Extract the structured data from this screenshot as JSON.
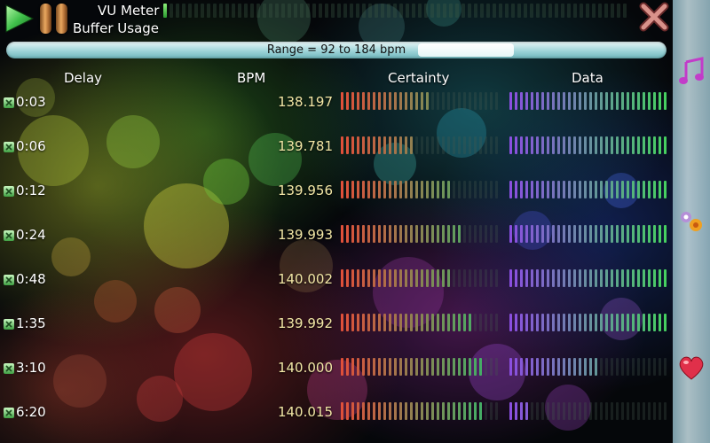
{
  "topbar": {
    "vu_label": "VU Meter",
    "buffer_label": "Buffer Usage"
  },
  "range": {
    "text": "Range = 92 to 184 bpm"
  },
  "columns": {
    "delay": "Delay",
    "bpm": "BPM",
    "certainty": "Certainty",
    "data": "Data"
  },
  "rows": [
    {
      "delay": "0:03",
      "bpm": "138.197",
      "certainty": 0.56,
      "data": 1.0
    },
    {
      "delay": "0:06",
      "bpm": "139.781",
      "certainty": 0.46,
      "data": 1.0
    },
    {
      "delay": "0:12",
      "bpm": "139.956",
      "certainty": 0.69,
      "data": 1.0
    },
    {
      "delay": "0:24",
      "bpm": "139.993",
      "certainty": 0.76,
      "data": 1.0
    },
    {
      "delay": "0:48",
      "bpm": "140.002",
      "certainty": 0.69,
      "data": 1.0
    },
    {
      "delay": "1:35",
      "bpm": "139.992",
      "certainty": 0.82,
      "data": 1.0
    },
    {
      "delay": "3:10",
      "bpm": "140.000",
      "certainty": 0.89,
      "data": 0.57
    },
    {
      "delay": "6:20",
      "bpm": "140.015",
      "certainty": 0.91,
      "data": 0.12
    }
  ],
  "icons": {
    "play": "play-icon",
    "pause": "pause-icon",
    "close": "close-icon",
    "music": "music-note-icon",
    "flowers": "flowers-icon",
    "heart": "heart-icon"
  },
  "colors": {
    "bpm_text": "#f3e7a6",
    "certainty_start": "#e0503a",
    "certainty_end": "#33b86a",
    "data_start": "#8a4fe0",
    "data_end": "#46d060",
    "unlit": "rgba(70,90,80,0.30)"
  }
}
